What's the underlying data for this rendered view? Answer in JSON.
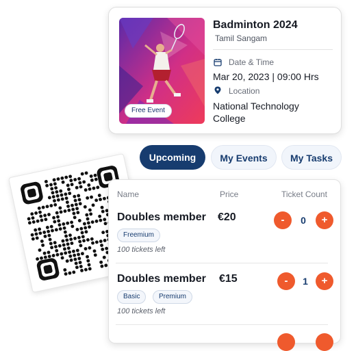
{
  "event": {
    "title": "Badminton 2024",
    "organizer": "Tamil Sangam",
    "badge": "Free Event",
    "date_label": "Date & Time",
    "date_value": "Mar 20, 2023 | 09:00 Hrs",
    "location_label": "Location",
    "location_line1": "National Technology",
    "location_line2": "College",
    "image_icon": "badminton-player-artwork"
  },
  "tabs": [
    {
      "label": "Upcoming",
      "active": true
    },
    {
      "label": "My Events",
      "active": false
    },
    {
      "label": "My Tasks",
      "active": false
    }
  ],
  "table": {
    "headers": {
      "name": "Name",
      "price": "Price",
      "count": "Ticket Count"
    },
    "rows": [
      {
        "name": "Doubles member",
        "price": "€20",
        "tags": [
          "Freemium"
        ],
        "left": "100 tickets left",
        "count": "0"
      },
      {
        "name": "Doubles member",
        "price": "€15",
        "tags": [
          "Basic",
          "Premium"
        ],
        "left": "100 tickets left",
        "count": "1"
      }
    ],
    "minus_label": "-",
    "plus_label": "+"
  },
  "colors": {
    "primary": "#173c6f",
    "accent": "#ef5a2d"
  }
}
